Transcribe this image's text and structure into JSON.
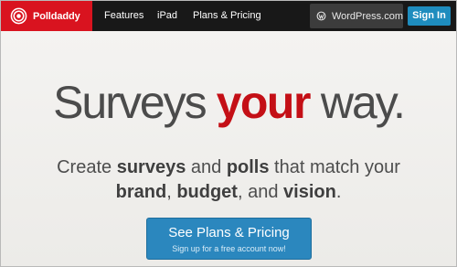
{
  "nav": {
    "brand": "Polldaddy",
    "links": [
      "Features",
      "iPad",
      "Plans & Pricing"
    ],
    "wordpress_label": "WordPress.com",
    "signin_label": "Sign In"
  },
  "hero": {
    "headline_part1": "Surveys ",
    "headline_accent": "your",
    "headline_part2": " way.",
    "sub1_a": "Create ",
    "sub1_b": "surveys",
    "sub1_c": " and ",
    "sub1_d": "polls",
    "sub1_e": " that match your",
    "sub2_a": "brand",
    "sub2_b": ", ",
    "sub2_c": "budget",
    "sub2_d": ", and ",
    "sub2_e": "vision",
    "sub2_f": "."
  },
  "cta": {
    "label": "See Plans & Pricing",
    "sublabel": "Sign up for a free account now!"
  },
  "colors": {
    "brand_red": "#d9131f",
    "accent_red": "#c40f16",
    "cta_blue": "#2b87be",
    "nav_dark": "#181818"
  },
  "icons": [
    "polldaddy-logo-icon",
    "wordpress-icon"
  ]
}
